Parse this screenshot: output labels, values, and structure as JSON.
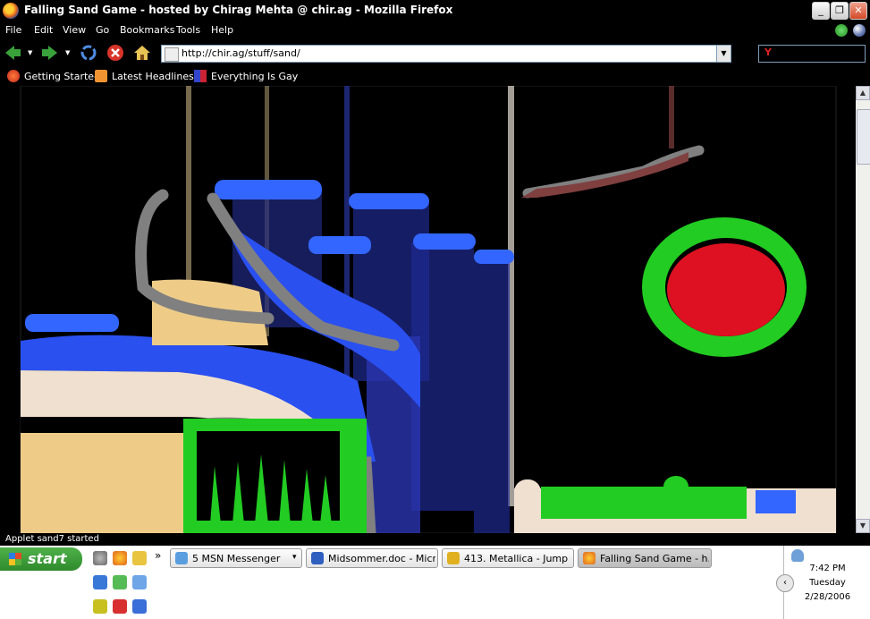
{
  "window": {
    "title": "Falling Sand Game - hosted by Chirag Mehta @ chir.ag - Mozilla Firefox"
  },
  "window_controls": {
    "minimize": "_",
    "maximize": "❐",
    "close": "✕"
  },
  "menu": [
    "File",
    "Edit",
    "View",
    "Go",
    "Bookmarks",
    "Tools",
    "Help"
  ],
  "url": {
    "value": "http://chir.ag/stuff/sand/",
    "dropdown": "▼"
  },
  "bookmarks": [
    {
      "label": "Getting Started",
      "icon": "firefox-bookmark-icon"
    },
    {
      "label": "Latest Headlines ▾",
      "icon": "rss-feed-icon"
    },
    {
      "label": "Everything Is Gay",
      "icon": "site-favicon"
    }
  ],
  "status": {
    "text": "Applet sand7 started"
  },
  "taskbar": {
    "start_label": "start",
    "chevron": "»",
    "tasks": [
      {
        "label": "5 MSN Messenger",
        "icon": "msn-icon",
        "active": false,
        "dropdown": "▾"
      },
      {
        "label": "Midsommer.doc - Micr...",
        "icon": "word-icon",
        "active": false
      },
      {
        "label": "413. Metallica - Jump ...",
        "icon": "winamp-icon",
        "active": false
      },
      {
        "label": "Falling Sand Game - h...",
        "icon": "firefox-icon",
        "active": true
      }
    ]
  },
  "clock": {
    "time": "7:42 PM",
    "day": "Tuesday",
    "date": "2/28/2006"
  },
  "colors": {
    "water": "#3366ff",
    "wall": "#808080",
    "sand": "#eecc88",
    "plant": "#22cc22",
    "fire": "#dd1122",
    "salt": "#f0e0d0",
    "oil": "#804040"
  }
}
